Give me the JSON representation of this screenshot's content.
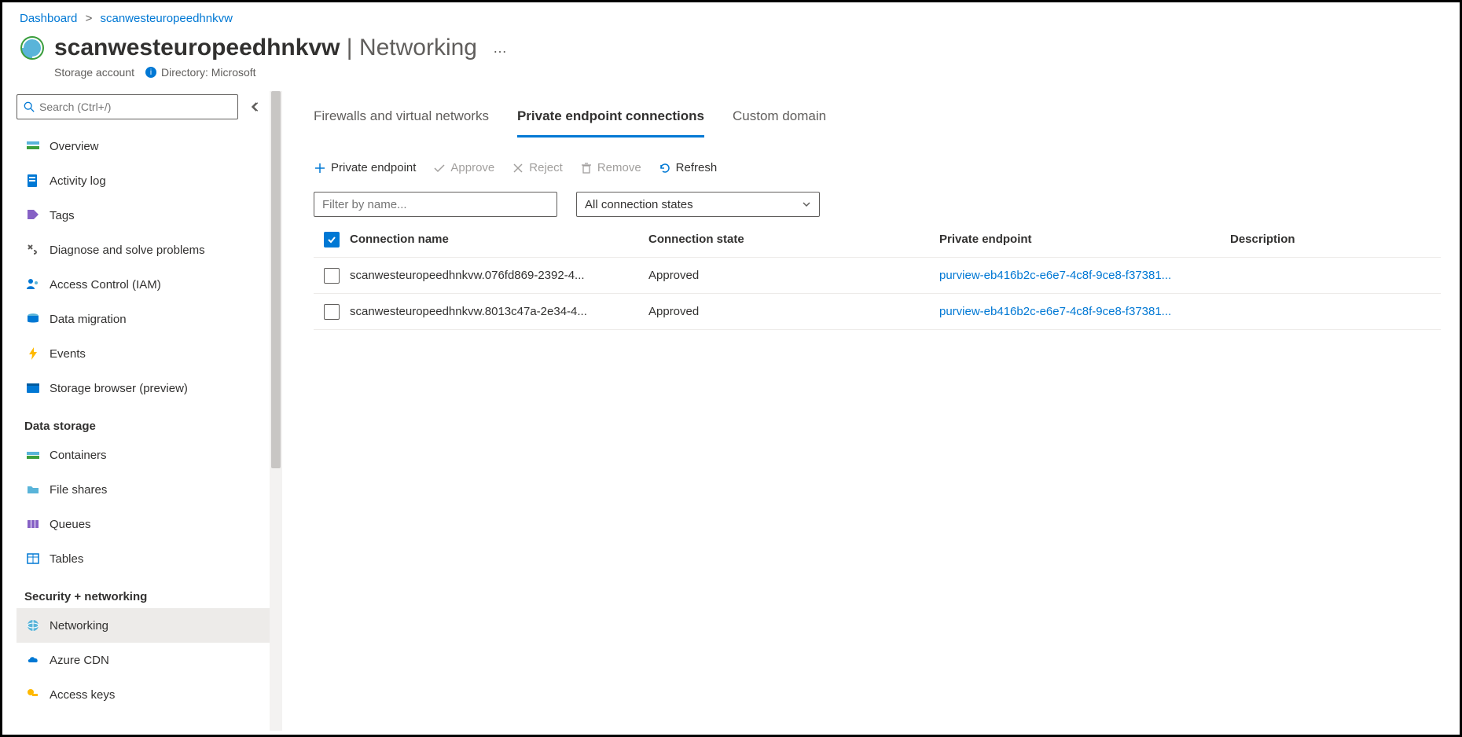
{
  "breadcrumb": {
    "root": "Dashboard",
    "current": "scanwesteuropeedhnkvw"
  },
  "header": {
    "title": "scanwesteuropeedhnkvw",
    "section": "Networking",
    "subtitle": "Storage account",
    "directory_label": "Directory:",
    "directory_value": "Microsoft"
  },
  "search": {
    "placeholder": "Search (Ctrl+/)"
  },
  "nav": {
    "items_top": [
      {
        "icon": "overview",
        "label": "Overview"
      },
      {
        "icon": "activity",
        "label": "Activity log"
      },
      {
        "icon": "tags",
        "label": "Tags"
      },
      {
        "icon": "diagnose",
        "label": "Diagnose and solve problems"
      },
      {
        "icon": "iam",
        "label": "Access Control (IAM)"
      },
      {
        "icon": "migration",
        "label": "Data migration"
      },
      {
        "icon": "events",
        "label": "Events"
      },
      {
        "icon": "browser",
        "label": "Storage browser (preview)"
      }
    ],
    "section_storage": "Data storage",
    "items_storage": [
      {
        "icon": "containers",
        "label": "Containers"
      },
      {
        "icon": "fileshares",
        "label": "File shares"
      },
      {
        "icon": "queues",
        "label": "Queues"
      },
      {
        "icon": "tables",
        "label": "Tables"
      }
    ],
    "section_security": "Security + networking",
    "items_security": [
      {
        "icon": "networking",
        "label": "Networking",
        "selected": true
      },
      {
        "icon": "cdn",
        "label": "Azure CDN"
      },
      {
        "icon": "keys",
        "label": "Access keys"
      }
    ]
  },
  "tabs": {
    "t0": "Firewalls and virtual networks",
    "t1": "Private endpoint connections",
    "t2": "Custom domain"
  },
  "toolbar": {
    "add": "Private endpoint",
    "approve": "Approve",
    "reject": "Reject",
    "remove": "Remove",
    "refresh": "Refresh"
  },
  "filters": {
    "name_placeholder": "Filter by name...",
    "state_label": "All connection states"
  },
  "table": {
    "headers": {
      "name": "Connection name",
      "state": "Connection state",
      "endpoint": "Private endpoint",
      "desc": "Description"
    },
    "rows": [
      {
        "name": "scanwesteuropeedhnkvw.076fd869-2392-4...",
        "state": "Approved",
        "endpoint": "purview-eb416b2c-e6e7-4c8f-9ce8-f37381...",
        "desc": ""
      },
      {
        "name": "scanwesteuropeedhnkvw.8013c47a-2e34-4...",
        "state": "Approved",
        "endpoint": "purview-eb416b2c-e6e7-4c8f-9ce8-f37381...",
        "desc": ""
      }
    ]
  }
}
